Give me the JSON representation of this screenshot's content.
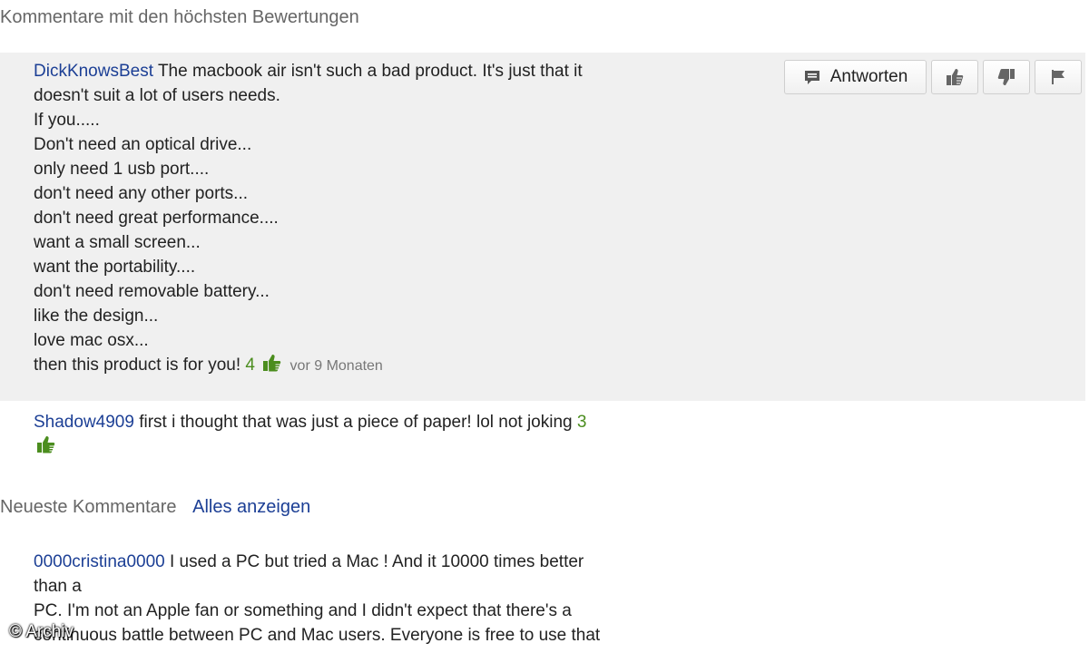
{
  "sections": {
    "top_title": "Kommentare mit den höchsten Bewertungen",
    "newest_label": "Neueste Kommentare",
    "show_all_link": "Alles anzeigen"
  },
  "actions": {
    "reply_label": "Antworten",
    "reply_icon": "comment-icon",
    "like_icon": "thumbs-up-icon",
    "dislike_icon": "thumbs-down-icon",
    "flag_icon": "flag-icon"
  },
  "comments": [
    {
      "author": "DickKnowsBest",
      "lines": [
        "The macbook air isn't such a bad product. It's just that it",
        "doesn't suit a lot of users needs.",
        "If you.....",
        "Don't need an optical drive...",
        "only need 1 usb port....",
        "don't need any other ports...",
        "don't need great performance....",
        "want a small screen...",
        "want the portability....",
        "don't need removable battery...",
        "like the design...",
        "love mac osx...",
        "then this product is for you!"
      ],
      "score": "4",
      "time": "vor 9 Monaten"
    },
    {
      "author": "Shadow4909",
      "lines": [
        "first i thought that was just a piece of paper! lol not joking"
      ],
      "score": "3"
    },
    {
      "author": "0000cristina0000",
      "lines": [
        "I used a PC but tried a Mac ! And it 10000 times better",
        "than a",
        "PC. I'm not an Apple fan or something and I didn't expect that there's a",
        "continuous battle between PC and Mac users. Everyone is free to use that"
      ]
    }
  ],
  "watermark": "© Archiv",
  "colors": {
    "link": "#1c3f95",
    "score_green": "#4b8d1e",
    "highlight_bg": "#f0f0f0",
    "muted_text": "#666666"
  }
}
